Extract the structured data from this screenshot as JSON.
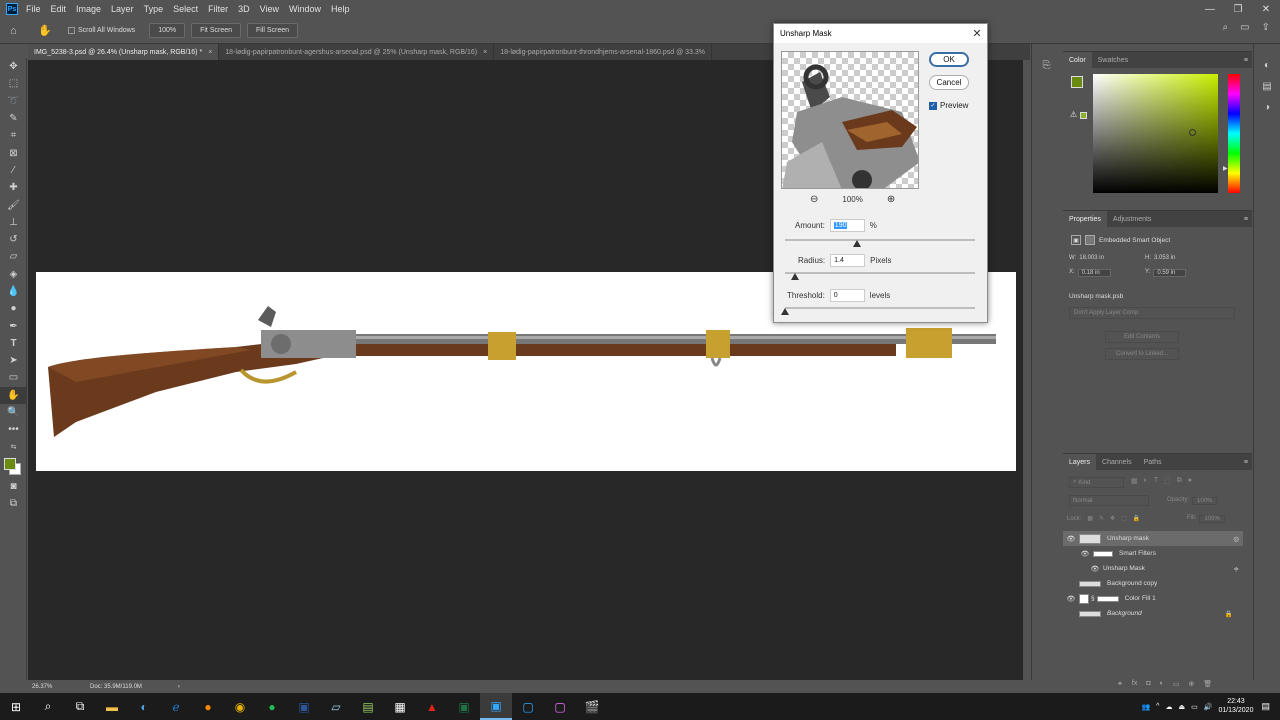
{
  "app": {
    "name": "Ps",
    "menu": [
      "File",
      "Edit",
      "Image",
      "Layer",
      "Type",
      "Select",
      "Filter",
      "3D",
      "View",
      "Window",
      "Help"
    ]
  },
  "options": {
    "scroll_all": "Scroll All Windows",
    "zoom_btn": "100%",
    "fit_btn": "Fit Screen",
    "fill_btn": "Fill Screen"
  },
  "tabs": [
    {
      "label": "IMG_5238-3.psd @ 26.4% (Unsharp mask, RGB/16) *",
      "close": "×"
    },
    {
      "label": "18-lødig-papirpatronbunt-agershus-arsenal.psd @ 25% (Unsharp mask, RGB/16)",
      "close": "×"
    },
    {
      "label": "18-lødig-papirpatronbunt-throndhjems-arsenal-1860.psd @ 33.3%",
      "close": ""
    }
  ],
  "status": {
    "zoom": "26.37%",
    "doc": "Doc: 35.9M/119.0M"
  },
  "dialog": {
    "title": "Unsharp Mask",
    "ok": "OK",
    "cancel": "Cancel",
    "preview": "Preview",
    "zoom": "100%",
    "amount_label": "Amount:",
    "amount_value": "190",
    "amount_unit": "%",
    "amount_level": 0.38,
    "radius_label": "Radius:",
    "radius_value": "1.4",
    "radius_unit": "Pixels",
    "radius_level": 0.05,
    "threshold_label": "Threshold:",
    "threshold_value": "0",
    "threshold_unit": "levels",
    "threshold_level": 0.0
  },
  "color_panel": {
    "tabs": [
      "Color",
      "Swatches"
    ],
    "fg": "#6a8a12",
    "bg": "#ffffff",
    "hue": "#c8f000"
  },
  "properties": {
    "tabs": [
      "Properties",
      "Adjustments"
    ],
    "type": "Embedded Smart Object",
    "w_label": "W:",
    "w": "18.003 in",
    "h_label": "H:",
    "h": "3.053 in",
    "x_label": "X:",
    "x": "0.18 in",
    "y_label": "Y:",
    "y": "0.59 in",
    "file": "Unsharp mask.psb",
    "comp": "Don't Apply Layer Comp",
    "edit": "Edit Contents",
    "convert": "Convert to Linked..."
  },
  "layers": {
    "tabs": [
      "Layers",
      "Channels",
      "Paths"
    ],
    "kind": "Kind",
    "blend": "Normal",
    "opacity_label": "Opacity:",
    "opacity": "100%",
    "lock_label": "Lock:",
    "fill_label": "Fill:",
    "fill": "100%",
    "items": [
      {
        "name": "Unsharp mask",
        "visible": true
      },
      {
        "name": "Smart Filters",
        "visible": true
      },
      {
        "name": "Unsharp Mask",
        "visible": true
      },
      {
        "name": "Background copy",
        "visible": false
      },
      {
        "name": "Color Fill 1",
        "visible": true
      },
      {
        "name": "Background",
        "visible": false
      }
    ]
  },
  "tray": {
    "time": "22:43",
    "date": "01/13/2020"
  }
}
